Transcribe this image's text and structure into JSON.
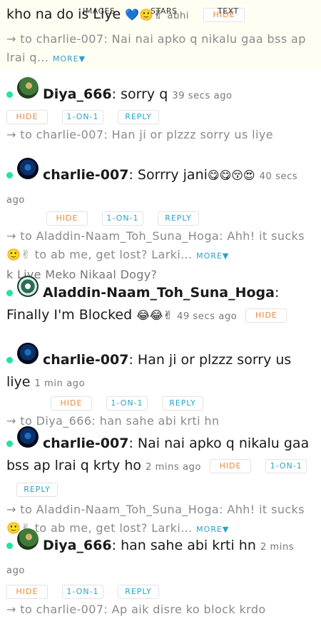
{
  "tabs": {
    "images": "IMAGES",
    "stars": "STARS",
    "text": "TEXT"
  },
  "buttons": {
    "hide": "HIDE",
    "one_on_one": "1-ON-1",
    "reply": "REPLY",
    "more": "MORE▼"
  },
  "top_message": {
    "text": "kho na do is Liye",
    "emoji": "💙🙂✌",
    "user": "abhi",
    "reply": "→ to charlie-007: Nai nai apko q nikalu gaa bss ap lrai q..."
  },
  "messages": [
    {
      "user": "Diya_666",
      "text": "sorry q",
      "time": "39 secs ago",
      "reply": "→ to charlie-007: Han ji or plzzz sorry us liye"
    },
    {
      "user": "charlie-007",
      "text": "Sorrry jani",
      "emoji": "😋😋😚😍",
      "time": "40 secs ago",
      "reply": "→ to Aladdin-Naam_Toh_Suna_Hoga: Ahh! it sucks",
      "reply2": "🙂✌ to ab me, get lost? Larki...",
      "extra": "k Liye Meko Nikaal Dogy?"
    },
    {
      "user": "Aladdin-Naam_Toh_Suna_Hoga",
      "text": "Finally I'm Blocked",
      "emoji": "😂😂✌",
      "time": "49 secs ago"
    },
    {
      "user": "charlie-007",
      "text": "Han ji or plzzz sorry us liye",
      "time": "1 min ago",
      "reply": "→ to Diya_666: han sahe abi krti hn"
    },
    {
      "user": "charlie-007",
      "text": "Nai nai apko q nikalu gaa bss ap lrai q krty ho",
      "time": "2 mins ago",
      "reply": "→ to Aladdin-Naam_Toh_Suna_Hoga: Ahh! it sucks",
      "reply2": "🙂✌ to ab me, get lost? Larki..."
    },
    {
      "user": "Diya_666",
      "text": "han sahe abi krti hn",
      "time": "2 mins ago",
      "reply": "→ to charlie-007: Ap aik disre ko block krdo"
    }
  ]
}
